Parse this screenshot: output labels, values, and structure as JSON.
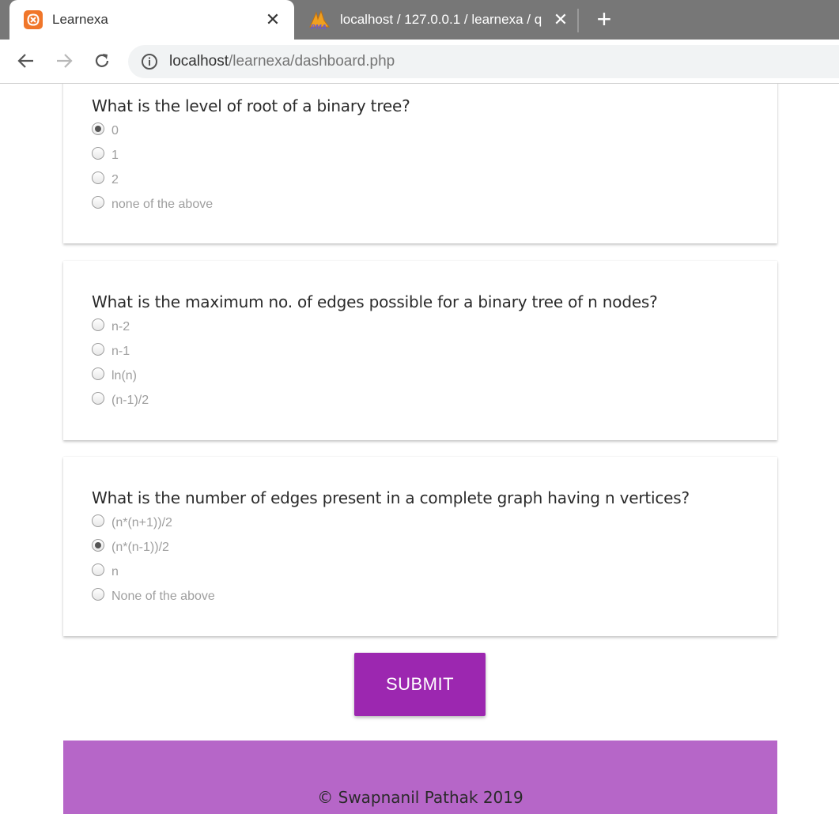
{
  "browser": {
    "tabs": [
      {
        "title": "Learnexa",
        "icon": "xampp-icon",
        "active": true
      },
      {
        "title": "localhost / 127.0.0.1 / learnexa / q",
        "icon": "phpmyadmin-icon",
        "active": false
      }
    ],
    "url_host": "localhost",
    "url_path": "/learnexa/dashboard.php"
  },
  "quiz": {
    "questions": [
      {
        "text": "What is the level of root of a binary tree?",
        "options": [
          "0",
          "1",
          "2",
          "none of the above"
        ],
        "selected_index": 0
      },
      {
        "text": "What is the maximum no. of edges possible for a binary tree of n nodes?",
        "options": [
          "n-2",
          "n-1",
          "ln(n)",
          "(n-1)/2"
        ],
        "selected_index": null
      },
      {
        "text": "What is the number of edges present in a complete graph having n vertices?",
        "options": [
          "(n*(n+1))/2",
          "(n*(n-1))/2",
          "n",
          "None of the above"
        ],
        "selected_index": 1
      }
    ],
    "submit_label": "SUBMIT"
  },
  "footer": {
    "text": "© Swapnanil Pathak 2019"
  },
  "colors": {
    "accent": "#9c27b0",
    "footer": "#b666c8",
    "tabstrip": "#777777"
  }
}
